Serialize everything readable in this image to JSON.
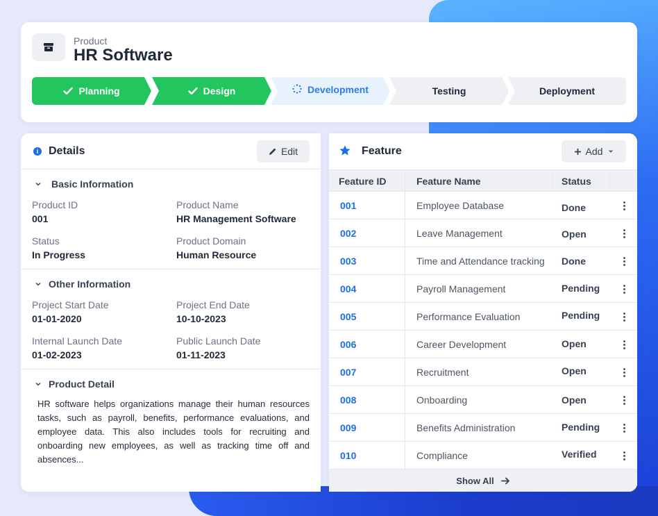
{
  "header": {
    "label": "Product",
    "title": "HR Software",
    "icon": "box-icon"
  },
  "steps": [
    {
      "label": "Planning",
      "state": "done"
    },
    {
      "label": "Design",
      "state": "done"
    },
    {
      "label": "Development",
      "state": "active"
    },
    {
      "label": "Testing",
      "state": "todo"
    },
    {
      "label": "Deployment",
      "state": "todo"
    }
  ],
  "details": {
    "title": "Details",
    "edit_label": "Edit",
    "basic": {
      "title": "Basic Information",
      "product_id_label": "Product ID",
      "product_id": "001",
      "product_name_label": "Product Name",
      "product_name": "HR Management Software",
      "status_label": "Status",
      "status": "In Progress",
      "domain_label": "Product Domain",
      "domain": "Human Resource"
    },
    "other": {
      "title": "Other Information",
      "start_label": "Project Start Date",
      "start": "01-01-2020",
      "end_label": "Project End Date",
      "end": "10-10-2023",
      "internal_label": "Internal Launch Date",
      "internal": "01-02-2023",
      "public_label": "Public Launch Date",
      "public": "01-11-2023"
    },
    "detail": {
      "title": "Product Detail",
      "text": "HR software helps organizations manage their human resources tasks, such as payroll, benefits, performance evaluations, and employee data. This also includes tools for recruiting and onboarding new employees, as well as tracking time off and absences..."
    }
  },
  "feature": {
    "title": "Feature",
    "add_label": "Add",
    "columns": [
      "Feature ID",
      "Feature Name",
      "Status"
    ],
    "rows": [
      {
        "id": "001",
        "name": "Employee Database",
        "status": "Done"
      },
      {
        "id": "002",
        "name": "Leave Management",
        "status": "Open"
      },
      {
        "id": "003",
        "name": "Time and Attendance tracking",
        "status": "Done"
      },
      {
        "id": "004",
        "name": "Payroll Management",
        "status": "Pending"
      },
      {
        "id": "005",
        "name": "Performance Evaluation",
        "status": "Pending"
      },
      {
        "id": "006",
        "name": "Career Development",
        "status": "Open"
      },
      {
        "id": "007",
        "name": "Recruitment",
        "status": "Open"
      },
      {
        "id": "008",
        "name": "Onboarding",
        "status": "Open"
      },
      {
        "id": "009",
        "name": "Benefits Administration",
        "status": "Pending"
      },
      {
        "id": "010",
        "name": "Compliance",
        "status": "Verified"
      }
    ],
    "show_all_label": "Show All"
  },
  "colors": {
    "done": "#22c55e",
    "active_bg": "#e8f2fd",
    "accent": "#1d6fe6"
  }
}
